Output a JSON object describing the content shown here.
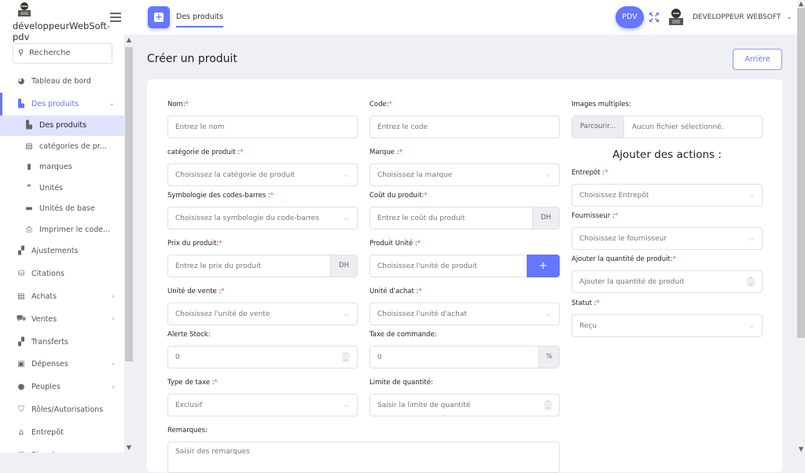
{
  "app": {
    "name": "développeurWebSoft-pdv"
  },
  "sidebar": {
    "search_placeholder": "Recherche",
    "items": [
      {
        "label": "Tableau de bord",
        "icon": "pie-chart-icon"
      },
      {
        "label": "Des produits",
        "icon": "boxes-icon",
        "expanded": true
      },
      {
        "label": "Des produits",
        "icon": "boxes-icon",
        "sub": true,
        "selected": true
      },
      {
        "label": "catégories de pr...",
        "icon": "layers-icon",
        "sub": true
      },
      {
        "label": "marques",
        "icon": "bookmark-icon",
        "sub": true
      },
      {
        "label": "Unités",
        "icon": "quote-icon",
        "sub": true
      },
      {
        "label": "Unités de base",
        "icon": "ruler-icon",
        "sub": true
      },
      {
        "label": "Imprimer le code...",
        "icon": "printer-icon",
        "sub": true
      },
      {
        "label": "Ajustements",
        "icon": "map-icon"
      },
      {
        "label": "Citations",
        "icon": "basket-icon"
      },
      {
        "label": "Achats",
        "icon": "receipt-icon",
        "chevron": true
      },
      {
        "label": "Ventes",
        "icon": "cart-icon",
        "chevron": true
      },
      {
        "label": "Transferts",
        "icon": "map-icon"
      },
      {
        "label": "Dépenses",
        "icon": "money-icon",
        "chevron": true
      },
      {
        "label": "Peuples",
        "icon": "user-icon",
        "chevron": true
      },
      {
        "label": "Rôles/Autorisations",
        "icon": "shield-icon"
      },
      {
        "label": "Entrepôt",
        "icon": "home-icon"
      },
      {
        "label": "Signaler",
        "icon": "chart-icon"
      }
    ]
  },
  "topbar": {
    "tab_label": "Des produits",
    "pdv_label": "PDV",
    "user_name": "DEVELOPPEUR WEBSOFT"
  },
  "page": {
    "title": "Créer un produit",
    "back_label": "Arrière"
  },
  "form": {
    "name": {
      "label": "Nom:",
      "placeholder": "Entrez le nom"
    },
    "code": {
      "label": "Code:",
      "placeholder": "Entrez le code"
    },
    "images": {
      "label": "Images multiples:",
      "browse": "Parcourir...",
      "status": "Aucun fichier sélectionné."
    },
    "category": {
      "label": "catégorie de produit :",
      "placeholder": "Choisissez la catégorie de produit"
    },
    "brand": {
      "label": "Marque :",
      "placeholder": "Choisissez la marque"
    },
    "symbology": {
      "label": "Symbologie des codes-barres :",
      "placeholder": "Choisissez la symbologie du code-barres"
    },
    "cost": {
      "label": "Coût du produit:",
      "placeholder": "Entrez le coût du produit",
      "addon": "DH"
    },
    "price": {
      "label": "Prix du produit:",
      "placeholder": "Entrez le prix du produit",
      "addon": "DH"
    },
    "unit": {
      "label": "Produit Unité :",
      "placeholder": "Choisissez l'unité de produit",
      "button": "+"
    },
    "sale_unit": {
      "label": "Unité de vente :",
      "placeholder": "Choisissez l'unité de vente"
    },
    "purchase_unit": {
      "label": "Unité d'achat :",
      "placeholder": "Choisissez l'unité d'achat"
    },
    "stock_alert": {
      "label": "Alerte Stock:",
      "value": "0"
    },
    "order_tax": {
      "label": "Taxe de commande:",
      "value": "0",
      "addon": "%"
    },
    "tax_type": {
      "label": "Type de taxe :",
      "value": "Exclusif"
    },
    "qty_limit": {
      "label": "Limite de quantité:",
      "placeholder": "Saisir la limite de quantité"
    },
    "notes": {
      "label": "Remarques:",
      "placeholder": "Saisir des remarques"
    },
    "actions_title": "Ajouter des actions :",
    "warehouse": {
      "label": "Entrepôt :",
      "placeholder": "Choisissez Entrepôt"
    },
    "supplier": {
      "label": "Fournisseur :",
      "placeholder": "Choisissez le fournisseur"
    },
    "quantity": {
      "label": "Ajouter la quantité de produit:",
      "placeholder": "Ajouter la quantité de produit"
    },
    "status": {
      "label": "Statut :",
      "value": "Reçu"
    },
    "required_mark": "*"
  }
}
